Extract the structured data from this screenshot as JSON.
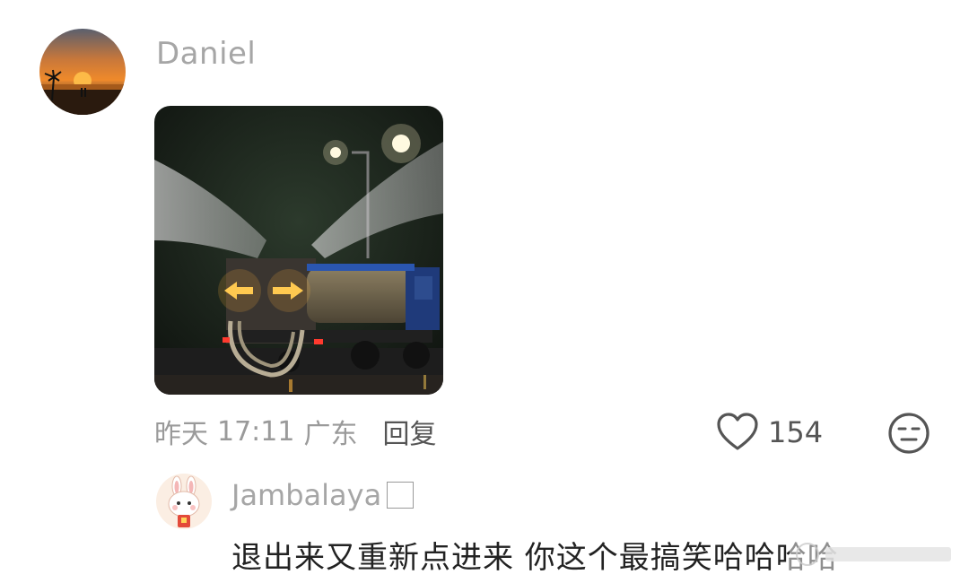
{
  "comment": {
    "username": "Daniel",
    "meta": {
      "time_label": "昨天",
      "time": "17:11",
      "location": "广东",
      "reply_label": "回复"
    },
    "likes": "154"
  },
  "reply": {
    "username": "Jambalaya",
    "text": "退出来又重新点进来 你这个最搞笑哈哈哈哈"
  },
  "colors": {
    "username": "#a6a6a6",
    "meta": "#9a9a9a",
    "body_text": "#222222",
    "icon": "#555555"
  },
  "icons": [
    "heart-outline-icon",
    "neutral-face-icon"
  ]
}
